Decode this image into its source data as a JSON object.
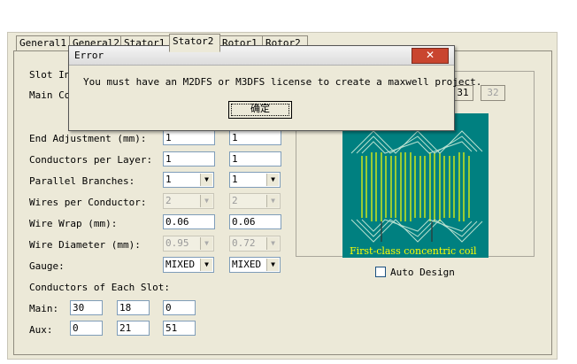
{
  "tabs": [
    "General1",
    "General2",
    "Stator1",
    "Stator2",
    "Rotor1",
    "Rotor2"
  ],
  "active_tab": "Stator2",
  "form": {
    "slot_insulation_label": "Slot In",
    "main_conductors_label": "Main Co",
    "end_adjustment": {
      "label": "End Adjustment  (mm):",
      "main": "1",
      "aux": "1"
    },
    "conductors_per_layer": {
      "label": "Conductors per Layer:",
      "main": "1",
      "aux": "1"
    },
    "parallel_branches": {
      "label": "Parallel Branches:",
      "main": "1",
      "aux": "1"
    },
    "wires_per_conductor": {
      "label": "Wires per Conductor:",
      "main": "2",
      "aux": "2"
    },
    "wire_wrap": {
      "label": "Wire Wrap  (mm):",
      "main": "0.06",
      "aux": "0.06"
    },
    "wire_diameter": {
      "label": "Wire Diameter  (mm):",
      "main": "0.95",
      "aux": "0.72"
    },
    "gauge": {
      "label": "Gauge:",
      "main": "MIXED",
      "aux": "MIXED"
    },
    "conductors_each_slot_label": "Conductors of Each Slot:",
    "main_row": {
      "label": "Main:",
      "values": [
        "30",
        "18",
        "0"
      ]
    },
    "aux_row": {
      "label": "Aux:",
      "values": [
        "0",
        "21",
        "51"
      ]
    }
  },
  "right_panel": {
    "button_31": "31",
    "button_32": "32",
    "picture_caption": "First-class concentric coil",
    "auto_design_label": "Auto Design"
  },
  "dialog": {
    "title": "Error",
    "close": "✕",
    "message": "You must have an M2DFS or M3DFS license to create a maxwell project.",
    "ok_label": "确定"
  },
  "colors": {
    "panel": "#ece9d8",
    "picture_bg": "#008080",
    "caption": "#ffff00",
    "close": "#c9452f"
  }
}
